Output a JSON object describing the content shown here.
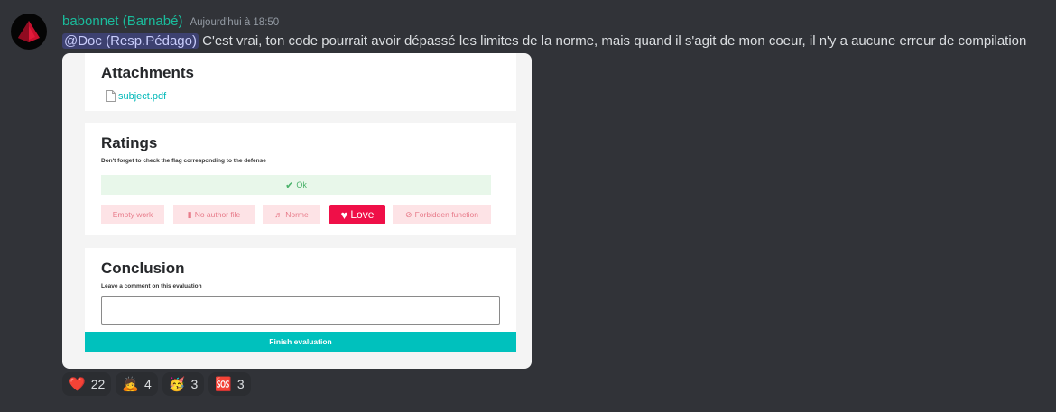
{
  "message": {
    "username": "babonnet (Barnabé)",
    "timestamp": "Aujourd'hui à 18:50",
    "mention": "@Doc (Resp.Pédago)",
    "text": "C'est vrai, ton code pourrait avoir dépassé les limites de la norme, mais quand il s'agit de mon coeur, il n'y a aucune erreur de compilation"
  },
  "attachment": {
    "attachments_section": {
      "title": "Attachments",
      "file_name": "subject.pdf",
      "file_icon": "document-icon"
    },
    "ratings_section": {
      "title": "Ratings",
      "hint": "Don't forget to check the flag corresponding to the defense",
      "ok_label": "Ok",
      "flags": [
        {
          "label": "Empty work",
          "icon": ""
        },
        {
          "label": "No author file",
          "icon": "file-icon"
        },
        {
          "label": "Norme",
          "icon": "music-note-icon"
        },
        {
          "label": "Love",
          "icon": "heart-icon"
        },
        {
          "label": "Forbidden function",
          "icon": "forbidden-icon"
        }
      ]
    },
    "conclusion_section": {
      "title": "Conclusion",
      "hint": "Leave a comment on this evaluation",
      "comment_value": "",
      "finish_label": "Finish evaluation"
    }
  },
  "reactions": [
    {
      "emoji": "❤️",
      "name": "heart",
      "count": "22"
    },
    {
      "emoji": "🙇",
      "name": "bowing",
      "count": "4"
    },
    {
      "emoji": "🥳",
      "name": "party-face",
      "count": "3"
    },
    {
      "emoji": "🆘",
      "name": "help-sign",
      "count": "3"
    }
  ],
  "colors": {
    "background": "#313338",
    "username": "#1abc9c",
    "accent_teal": "#00c1bd",
    "love_red": "#ef0f48"
  }
}
